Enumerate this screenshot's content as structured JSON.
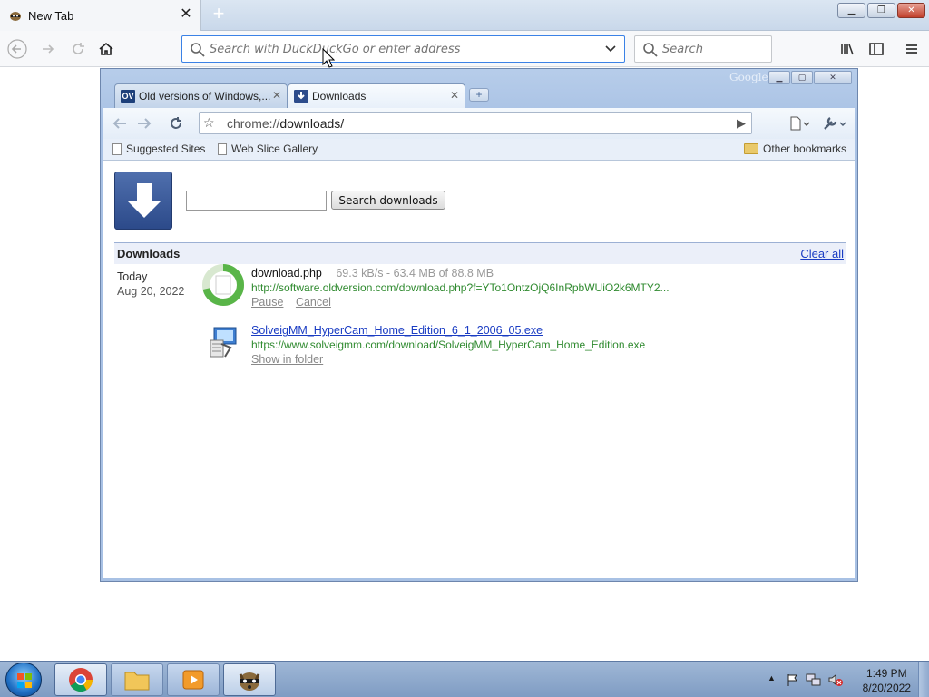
{
  "firefox": {
    "tab_title": "New Tab",
    "urlbar_placeholder": "Search with DuckDuckGo or enter address",
    "search_placeholder": "Search"
  },
  "chrome": {
    "brand_watermark": "Google",
    "tabs": [
      {
        "label": "Old versions of Windows,...",
        "favicon_text": "OV"
      },
      {
        "label": "Downloads"
      }
    ],
    "omnibox": {
      "scheme": "chrome://",
      "host": "downloads/"
    },
    "bookmarks": {
      "items": [
        "Suggested Sites",
        "Web Slice Gallery"
      ],
      "other": "Other bookmarks"
    }
  },
  "downloads_page": {
    "search_button": "Search downloads",
    "heading": "Downloads",
    "clear_all": "Clear all",
    "date_label": "Today",
    "date_value": "Aug 20, 2022",
    "items": [
      {
        "filename": "download.php",
        "status": "69.3 kB/s - 63.4 MB of 88.8 MB",
        "progress": 0.714,
        "url": "http://software.oldversion.com/download.php?f=YTo1OntzOjQ6InRpbWUiO2k6MTY2...",
        "actions": [
          "Pause",
          "Cancel"
        ]
      },
      {
        "filename": "SolveigMM_HyperCam_Home_Edition_6_1_2006_05.exe",
        "url": "https://www.solveigmm.com/download/SolveigMM_HyperCam_Home_Edition.exe",
        "actions": [
          "Show in folder"
        ]
      }
    ]
  },
  "taskbar": {
    "time": "1:49 PM",
    "date": "8/20/2022"
  },
  "colors": {
    "url_green": "#2f8a2f",
    "link_blue": "#1a3cc3",
    "firefox_focus": "#3b82e6"
  }
}
